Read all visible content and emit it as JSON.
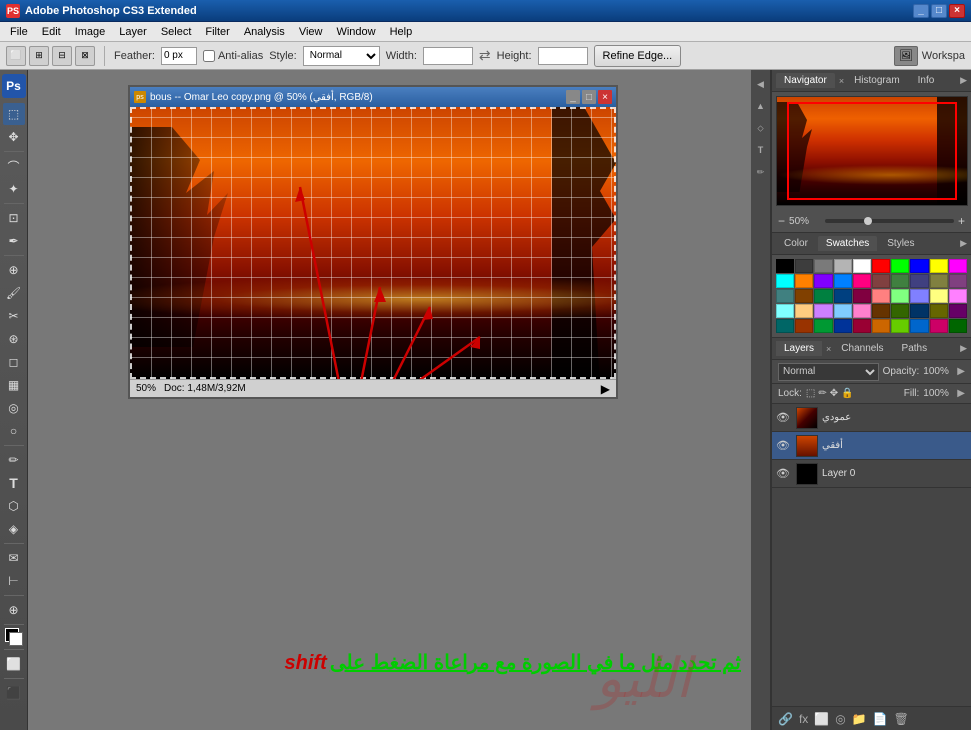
{
  "titlebar": {
    "icon": "PS",
    "title": "Adobe Photoshop CS3 Extended",
    "buttons": [
      "_",
      "□",
      "×"
    ]
  },
  "menubar": {
    "items": [
      "File",
      "Edit",
      "Image",
      "Layer",
      "Select",
      "Filter",
      "Analysis",
      "View",
      "Window",
      "Help"
    ]
  },
  "optionsbar": {
    "feather_label": "Feather:",
    "feather_value": "0 px",
    "antialiased_label": "Anti-alias",
    "style_label": "Style:",
    "style_value": "Normal",
    "width_label": "Width:",
    "height_label": "Height:",
    "refine_btn": "Refine Edge...",
    "workspace_label": "Workspa"
  },
  "document": {
    "title": "bous -- Omar Leo copy.png @ 50% (أفقي, RGB/8)",
    "zoom": "50%",
    "doc_info": "Doc: 1,48M/3,92M"
  },
  "navigator": {
    "tabs": [
      "Navigator",
      "Histogram",
      "Info"
    ],
    "zoom_value": "50%"
  },
  "swatches": {
    "tab_label": "Swatches",
    "color_tab": "Color",
    "styles_tab": "Styles"
  },
  "layers": {
    "tabs": [
      "Layers",
      "Channels",
      "Paths"
    ],
    "mode": "Normal",
    "opacity_label": "Opacity:",
    "opacity_value": "100%",
    "lock_label": "Lock:",
    "fill_label": "Fill:",
    "fill_value": "100%",
    "layer_items": [
      {
        "name": "عمودي",
        "type": "gradient",
        "visible": true,
        "active": false
      },
      {
        "name": "أفقي",
        "type": "image",
        "visible": true,
        "active": true
      },
      {
        "name": "Layer 0",
        "type": "black",
        "visible": true,
        "active": false
      }
    ]
  },
  "arabic_annotation": {
    "text": "ثم تحدد مثل ما في الصورة مع مراعاة الضغط على",
    "shift_text": "shift"
  },
  "swatches_colors": [
    "#000000",
    "#3d3d3d",
    "#7a7a7a",
    "#b4b4b4",
    "#ffffff",
    "#ff0000",
    "#00ff00",
    "#0000ff",
    "#ffff00",
    "#ff00ff",
    "#00ffff",
    "#ff8000",
    "#8000ff",
    "#0080ff",
    "#ff0080",
    "#804040",
    "#408040",
    "#404080",
    "#808040",
    "#804080",
    "#408080",
    "#804000",
    "#008040",
    "#004080",
    "#800040",
    "#ff8080",
    "#80ff80",
    "#8080ff",
    "#ffff80",
    "#ff80ff",
    "#80ffff",
    "#ffcc80",
    "#cc80ff",
    "#80ccff",
    "#ff80cc",
    "#663300",
    "#336600",
    "#003366",
    "#666600",
    "#660066",
    "#006666",
    "#993300",
    "#009933",
    "#003399",
    "#990033",
    "#cc6600",
    "#66cc00",
    "#0066cc",
    "#cc0066",
    "#006600"
  ]
}
